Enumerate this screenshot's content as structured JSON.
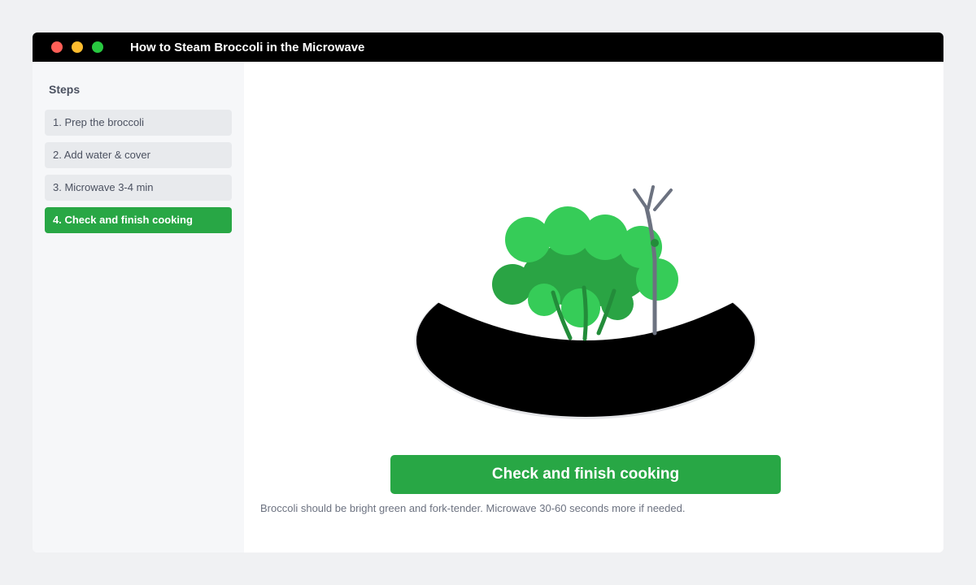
{
  "window": {
    "title": "How to Steam Broccoli in the Microwave"
  },
  "sidebar": {
    "heading": "Steps",
    "items": [
      {
        "label": "1. Prep the broccoli",
        "active": false
      },
      {
        "label": "2. Add water & cover",
        "active": false
      },
      {
        "label": "3. Microwave 3-4 min",
        "active": false
      },
      {
        "label": "4. Check and finish cooking",
        "active": true
      }
    ]
  },
  "main": {
    "illustration": {
      "bowl_color": "#000000",
      "broccoli_light": "#36cc58",
      "broccoli_dark": "#2aa444",
      "stem_color": "#238c3a",
      "fork_color": "#6c7280"
    },
    "button_label": "Check and finish cooking",
    "hint": "Broccoli should be bright green and fork-tender. Microwave 30-60 seconds more if needed."
  },
  "colors": {
    "accent": "#28a745",
    "titlebar": "#000000",
    "background": "#f0f1f3"
  }
}
